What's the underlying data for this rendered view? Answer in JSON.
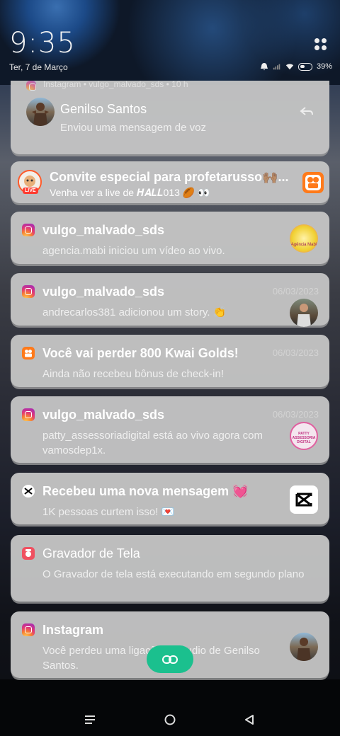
{
  "status": {
    "time": "9:35",
    "date": "Ter, 7 de Março",
    "battery": "39%"
  },
  "notifications": [
    {
      "header": "Instagram • vulgo_malvado_sds • 10 h",
      "title": "Genilso Santos",
      "body": "Enviou uma mensagem de voz"
    },
    {
      "title": "Convite especial para profetarusso🙌🏽...",
      "body": "Venha ver a live de 𝑯𝑨𝑳𝑳013 🏉 👀",
      "live_badge": "LIVE"
    },
    {
      "title": "vulgo_malvado_sds",
      "body": "agencia.mabi iniciou um vídeo ao vivo.",
      "thumb_text": "Agência Mabi"
    },
    {
      "title": "vulgo_malvado_sds",
      "time": "06/03/2023",
      "body": "andrecarlos381 adicionou um story. 👏"
    },
    {
      "title": "Você vai perder 800 Kwai Golds!",
      "time": "06/03/2023",
      "body": "Ainda não recebeu bônus de check-in!"
    },
    {
      "title": "vulgo_malvado_sds",
      "time": "06/03/2023",
      "body": "patty_assessoriadigital está ao vivo agora com vamosdep1x.",
      "thumb_text": "PATTY ASSESSORIA DIGITAL"
    },
    {
      "title": "Recebeu uma nova mensagem 💓",
      "body": "1K pessoas curtem isso! 💌"
    },
    {
      "title": "Gravador de Tela",
      "body": "O Gravador de tela está executando em segundo plano"
    },
    {
      "title": "Instagram",
      "body": "Você perdeu uma ligação de áudio de Genilso Santos."
    }
  ]
}
